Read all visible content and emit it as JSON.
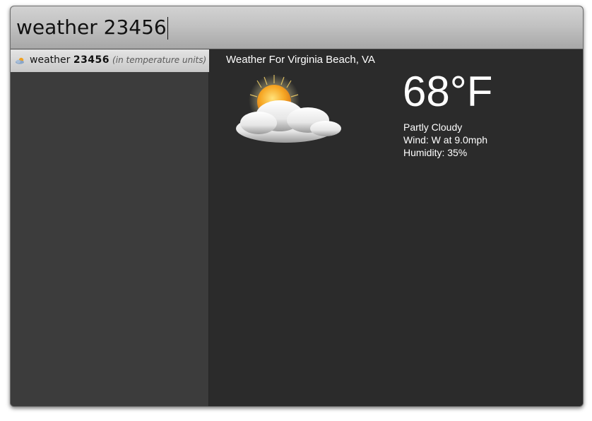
{
  "search": {
    "query": "weather 23456"
  },
  "results": [
    {
      "icon": "cloud-sun-icon",
      "keyword": "weather",
      "argument": "23456",
      "hint": "(in temperature units)"
    }
  ],
  "weather": {
    "title": "Weather For Virginia Beach, VA",
    "icon": "partly-cloudy-icon",
    "temperature": "68°F",
    "condition": "Partly Cloudy",
    "wind": "Wind: W at 9.0mph",
    "humidity": "Humidity: 35%"
  },
  "colors": {
    "panel_bg": "#2b2b2b",
    "sidebar_bg": "#3c3c3c",
    "selected_item": "#d9d9d9",
    "text_light": "#ffffff"
  }
}
